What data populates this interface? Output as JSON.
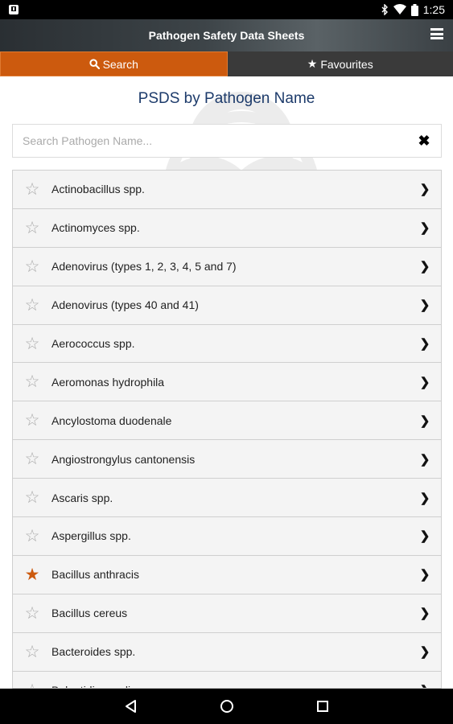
{
  "status": {
    "time": "1:25"
  },
  "header": {
    "title": "Pathogen Safety Data Sheets",
    "menu_icon": "hamburger-menu-icon"
  },
  "tabs": [
    {
      "label": "Search",
      "icon": "search-icon",
      "active": true
    },
    {
      "label": "Favourites",
      "icon": "star-icon",
      "active": false
    }
  ],
  "page": {
    "title": "PSDS by Pathogen Name"
  },
  "search": {
    "placeholder": "Search Pathogen Name...",
    "value": ""
  },
  "list": {
    "items": [
      {
        "label": "Actinobacillus spp.",
        "favourite": false
      },
      {
        "label": "Actinomyces spp.",
        "favourite": false
      },
      {
        "label": "Adenovirus (types 1, 2, 3, 4, 5 and 7)",
        "favourite": false
      },
      {
        "label": "Adenovirus (types 40 and 41)",
        "favourite": false
      },
      {
        "label": "Aerococcus spp.",
        "favourite": false
      },
      {
        "label": "Aeromonas hydrophila",
        "favourite": false
      },
      {
        "label": "Ancylostoma duodenale",
        "favourite": false
      },
      {
        "label": "Angiostrongylus cantonensis",
        "favourite": false
      },
      {
        "label": "Ascaris spp.",
        "favourite": false
      },
      {
        "label": "Aspergillus spp.",
        "favourite": false
      },
      {
        "label": "Bacillus anthracis",
        "favourite": true
      },
      {
        "label": "Bacillus cereus",
        "favourite": false
      },
      {
        "label": "Bacteroides spp.",
        "favourite": false
      },
      {
        "label": "Balantidium coli",
        "favourite": false
      }
    ]
  },
  "colors": {
    "accent": "#cc5a0e",
    "title_blue": "#1d3b6b"
  }
}
